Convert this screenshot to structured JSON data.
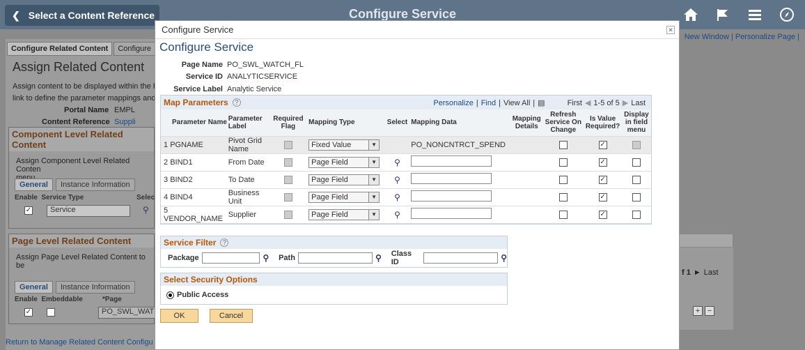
{
  "top": {
    "back_label": "Select a Content Reference",
    "title": "Configure Service"
  },
  "background": {
    "links": "New Window | Personalize Page |",
    "tabs": [
      "Configure Related Content",
      "Configure"
    ],
    "heading": "Assign Related Content",
    "desc1": "Assign content to be displayed within the R",
    "desc2": "link to define the parameter mappings and",
    "portal_label": "Portal Name",
    "portal_value": "EMPL",
    "content_ref_label": "Content Reference",
    "content_ref_value": "Suppli",
    "comp_section": "Component Level Related Content",
    "comp_desc1": "Assign Component Level Related Conten",
    "comp_desc2": "menu.",
    "comp_tabs": [
      "General",
      "Instance Information"
    ],
    "comp_cols": "Enable  Service Type",
    "comp_sel": "Selec",
    "comp_service": "Service",
    "page_section": "Page Level Related Content",
    "page_desc": "Assign Page Level Related Content to be",
    "page_tabs": [
      "General",
      "Instance Information"
    ],
    "page_cols": "Enable  Embeddable",
    "page_col3": "*Page",
    "page_value": "PO_SWL_WAT",
    "right_nav": "f 1",
    "right_last": "Last",
    "return_link": "Return to Manage Related Content Configu"
  },
  "dialog": {
    "title": "Configure Service",
    "heading": "Configure Service",
    "page_name_label": "Page Name",
    "page_name": "PO_SWL_WATCH_FL",
    "service_id_label": "Service ID",
    "service_id": "ANALYTICSERVICE",
    "service_label_label": "Service Label",
    "service_label": "Analytic Service"
  },
  "map_params": {
    "title": "Map Parameters",
    "personalize": "Personalize",
    "find": "Find",
    "view_all": "View All",
    "first": "First",
    "range": "1-5 of 5",
    "last": "Last",
    "columns": [
      "Parameter Name",
      "Parameter Label",
      "Required Flag",
      "Mapping Type",
      "Select",
      "Mapping Data",
      "Mapping Details",
      "Refresh Service On Change",
      "Is Value Required?",
      "Display in field menu"
    ],
    "rows": [
      {
        "num": "1",
        "name": "PGNAME",
        "label": "Pivot Grid Name",
        "mapping": "Fixed Value",
        "data": "PO_NONCNTRCT_SPEND"
      },
      {
        "num": "2",
        "name": "BIND1",
        "label": "From Date",
        "mapping": "Page Field",
        "data": ""
      },
      {
        "num": "3",
        "name": "BIND2",
        "label": "To Date",
        "mapping": "Page Field",
        "data": ""
      },
      {
        "num": "4",
        "name": "BIND4",
        "label": "Business Unit",
        "mapping": "Page Field",
        "data": ""
      },
      {
        "num": "5",
        "name": "VENDOR_NAME",
        "label": "Supplier",
        "mapping": "Page Field",
        "data": ""
      }
    ]
  },
  "service_filter": {
    "title": "Service Filter",
    "package": "Package",
    "path": "Path",
    "class_id": "Class ID"
  },
  "security": {
    "title": "Select Security Options",
    "public": "Public Access"
  },
  "buttons": {
    "ok": "OK",
    "cancel": "Cancel"
  }
}
